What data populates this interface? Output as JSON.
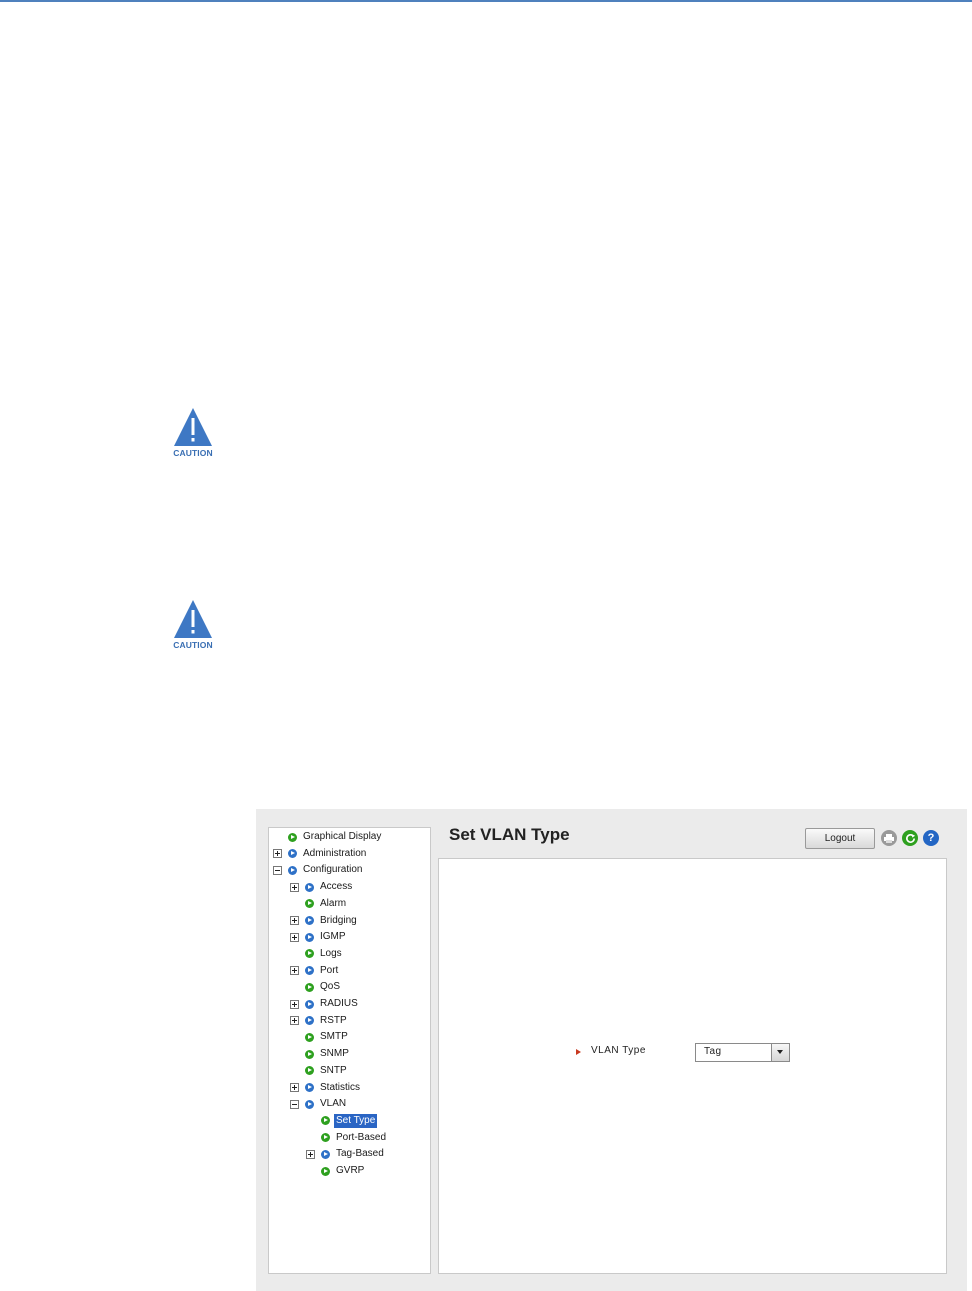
{
  "caution_label": "CAUTION",
  "nav": {
    "items": [
      {
        "label": "Graphical Display",
        "toggle": "none",
        "bullet": "green",
        "selected": false
      },
      {
        "label": "Administration",
        "toggle": "plus",
        "bullet": "blue",
        "selected": false
      },
      {
        "label": "Configuration",
        "toggle": "minus",
        "bullet": "blue",
        "selected": false
      },
      {
        "label": "Access",
        "toggle": "plus",
        "bullet": "blue",
        "selected": false
      },
      {
        "label": "Alarm",
        "toggle": "none",
        "bullet": "green",
        "selected": false
      },
      {
        "label": "Bridging",
        "toggle": "plus",
        "bullet": "blue",
        "selected": false
      },
      {
        "label": "IGMP",
        "toggle": "plus",
        "bullet": "blue",
        "selected": false
      },
      {
        "label": "Logs",
        "toggle": "none",
        "bullet": "green",
        "selected": false
      },
      {
        "label": "Port",
        "toggle": "plus",
        "bullet": "blue",
        "selected": false
      },
      {
        "label": "QoS",
        "toggle": "none",
        "bullet": "green",
        "selected": false
      },
      {
        "label": "RADIUS",
        "toggle": "plus",
        "bullet": "blue",
        "selected": false
      },
      {
        "label": "RSTP",
        "toggle": "plus",
        "bullet": "blue",
        "selected": false
      },
      {
        "label": "SMTP",
        "toggle": "none",
        "bullet": "green",
        "selected": false
      },
      {
        "label": "SNMP",
        "toggle": "none",
        "bullet": "green",
        "selected": false
      },
      {
        "label": "SNTP",
        "toggle": "none",
        "bullet": "green",
        "selected": false
      },
      {
        "label": "Statistics",
        "toggle": "plus",
        "bullet": "blue",
        "selected": false
      },
      {
        "label": "VLAN",
        "toggle": "minus",
        "bullet": "blue",
        "selected": false
      },
      {
        "label": "Set Type",
        "toggle": "none",
        "bullet": "green",
        "selected": true
      },
      {
        "label": "Port-Based",
        "toggle": "none",
        "bullet": "green",
        "selected": false
      },
      {
        "label": "Tag-Based",
        "toggle": "plus",
        "bullet": "blue",
        "selected": false
      },
      {
        "label": "GVRP",
        "toggle": "none",
        "bullet": "green",
        "selected": false
      }
    ]
  },
  "header": {
    "title": "Set VLAN Type",
    "logout_label": "Logout",
    "icons": [
      "printer-icon",
      "refresh-icon",
      "help-icon"
    ],
    "help_glyph": "?"
  },
  "form": {
    "vlan_type_label": "VLAN Type",
    "vlan_type_value": "Tag"
  },
  "colors": {
    "accent_rule": "#4f81bd",
    "selected_bg": "#2a65c4",
    "bullet_green": "#2ea01f",
    "bullet_blue": "#2e71c7",
    "field_arrow": "#c8381f"
  }
}
